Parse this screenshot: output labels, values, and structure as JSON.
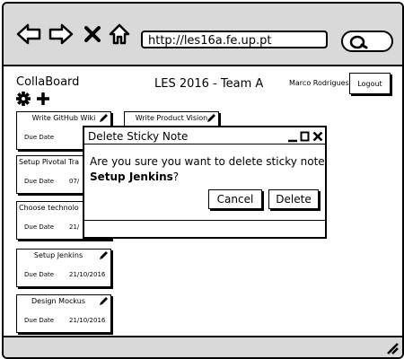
{
  "browser": {
    "url": "http://les16a.fe.up.pt",
    "icons": [
      "back-arrow-icon",
      "forward-arrow-icon",
      "close-x-icon",
      "home-icon",
      "search-icon"
    ]
  },
  "header": {
    "app_title": "CollaBoard",
    "team_title": "LES 2016 - Team A",
    "user_name": "Marco Rodrigues",
    "logout_label": "Logout",
    "toolbar_icons": [
      "gear-icon",
      "plus-icon"
    ]
  },
  "notes": [
    {
      "title": "Write GitHub Wiki",
      "label": "Due Date",
      "date": ""
    },
    {
      "title": "Write Product Vision",
      "label": "",
      "date": ""
    },
    {
      "title": "Setup Pivotal Tra",
      "label": "Due Date",
      "date": "07/"
    },
    {
      "title": "Choose technolo",
      "label": "Due Date",
      "date": "21/"
    },
    {
      "title": "Setup Jenkins",
      "label": "Due Date",
      "date": "21/10/2016"
    },
    {
      "title": "Design Mockus",
      "label": "Due Date",
      "date": "21/10/2016"
    }
  ],
  "modal": {
    "title": "Delete Sticky Note",
    "message": "Are you sure you want to delete sticky note",
    "note_name": "Setup Jenkins",
    "suffix": "?",
    "cancel_label": "Cancel",
    "delete_label": "Delete",
    "window_controls": [
      "minimize-icon",
      "maximize-icon",
      "close-icon"
    ]
  }
}
